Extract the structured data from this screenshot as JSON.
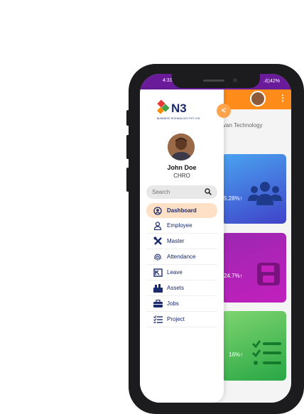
{
  "status": {
    "time": "4:31",
    "battery": "42%"
  },
  "header": {
    "company_partial": "van Technology"
  },
  "drawer": {
    "brand": "N3",
    "brand_sub": "BUSINESS TECHNOLOGY PVT. LTD.",
    "user_name": "John Doe",
    "user_role": "CHRO",
    "search_placeholder": "Search",
    "items": [
      {
        "label": "Dashboard",
        "icon": "dashboard-icon",
        "active": true
      },
      {
        "label": "Employee",
        "icon": "person-icon",
        "active": false
      },
      {
        "label": "Master",
        "icon": "tools-icon",
        "active": false
      },
      {
        "label": "Attendance",
        "icon": "fingerprint-icon",
        "active": false
      },
      {
        "label": "Leave",
        "icon": "leave-icon",
        "active": false
      },
      {
        "label": "Assets",
        "icon": "assets-icon",
        "active": false
      },
      {
        "label": "Jobs",
        "icon": "briefcase-icon",
        "active": false
      },
      {
        "label": "Project",
        "icon": "checklist-icon",
        "active": false
      }
    ]
  },
  "cards": [
    {
      "value": "5.28%↑",
      "icon": "users-icon",
      "colors": [
        "#4aa3f0",
        "#3f43c9"
      ]
    },
    {
      "value": "24.7%↑",
      "icon": "save-icon",
      "colors": [
        "#9c27b0",
        "#c21fbd"
      ]
    },
    {
      "value": "16%↑",
      "icon": "checklist-icon",
      "colors": [
        "#7ed56f",
        "#28a745"
      ]
    }
  ],
  "colors": {
    "status_bar": "#6a1b9a",
    "app_bar": "#ff8c1a",
    "active_bg": "#fde0c6",
    "menu_text": "#1a2a6c"
  }
}
